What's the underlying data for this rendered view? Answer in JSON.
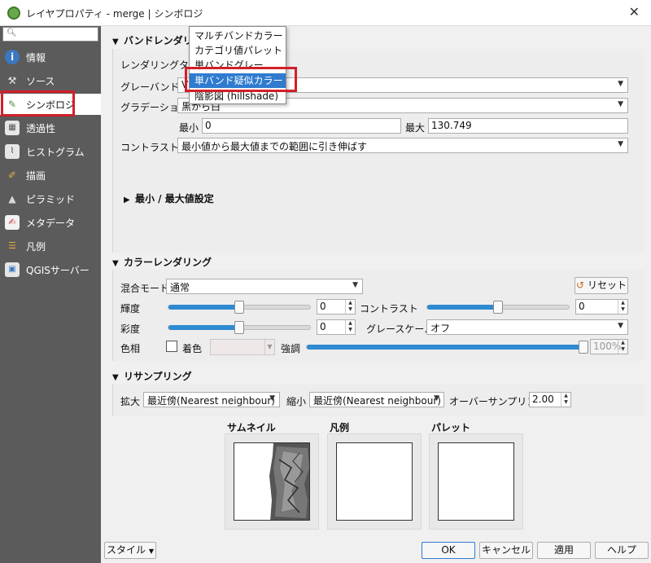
{
  "window": {
    "title": "レイヤプロパティ - merge | シンボロジ",
    "close_icon": "close-icon"
  },
  "sidebar": {
    "search_icon": "search-icon",
    "items": [
      {
        "label": "情報",
        "icon": "info-icon"
      },
      {
        "label": "ソース",
        "icon": "source-icon"
      },
      {
        "label": "シンボロジ",
        "icon": "symbology-icon"
      },
      {
        "label": "透過性",
        "icon": "transparency-icon"
      },
      {
        "label": "ヒストグラム",
        "icon": "histogram-icon"
      },
      {
        "label": "描画",
        "icon": "rendering-icon"
      },
      {
        "label": "ピラミッド",
        "icon": "pyramid-icon"
      },
      {
        "label": "メタデータ",
        "icon": "metadata-icon"
      },
      {
        "label": "凡例",
        "icon": "legend-icon"
      },
      {
        "label": "QGISサーバー",
        "icon": "server-icon"
      }
    ]
  },
  "band_rendering": {
    "section_label": "バンドレンダリン",
    "render_type_label": "レンダリングタイプ",
    "grey_band_label": "グレーバンド",
    "grey_band_value": "V",
    "gradient_label": "グラデーション",
    "gradient_value": "黒から白",
    "min_label": "最小",
    "min_value": "0",
    "max_label": "最大",
    "max_value": "130.749",
    "contrast_label": "コントラスト",
    "contrast_value": "最小値から最大値までの範囲に引き伸ばす",
    "minmax_label": "最小 / 最大値設定"
  },
  "render_type_dropdown": {
    "options": [
      "マルチバンドカラー",
      "カテゴリ値パレット",
      "単バンドグレー",
      "単バンド疑似カラー",
      "陰影図 (hillshade)"
    ],
    "selected_index": 3
  },
  "color_rendering": {
    "section_label": "カラーレンダリング",
    "blend_label": "混合モード",
    "blend_value": "通常",
    "reset_label": "リセット",
    "brightness_label": "輝度",
    "brightness_value": "0",
    "brightness_level": 0.5,
    "contrast_label": "コントラスト",
    "contrast_value": "0",
    "contrast_level": 0.5,
    "saturation_label": "彩度",
    "saturation_value": "0",
    "saturation_level": 0.5,
    "grayscale_label": "グレースケール",
    "grayscale_value": "オフ",
    "hue_label": "色相",
    "colorize_label": "着色",
    "strength_label": "強調",
    "strength_value": "100%",
    "strength_level": 1.0
  },
  "resampling": {
    "section_label": "リサンプリング",
    "zoom_in_label": "拡大",
    "zoom_in_value": "最近傍(Nearest neighbour)",
    "zoom_out_label": "縮小",
    "zoom_out_value": "最近傍(Nearest neighbour)",
    "oversampling_label": "オーバーサンプリング",
    "oversampling_value": "2.00"
  },
  "previews": {
    "thumbnail_label": "サムネイル",
    "legend_label": "凡例",
    "palette_label": "パレット"
  },
  "footer": {
    "style_label": "スタイル",
    "ok_label": "OK",
    "cancel_label": "キャンセル",
    "apply_label": "適用",
    "help_label": "ヘルプ"
  },
  "colors": {
    "accent": "#2f7bd0",
    "highlight_red": "#d21f2a",
    "sidebar_bg": "#5b5b5b"
  }
}
